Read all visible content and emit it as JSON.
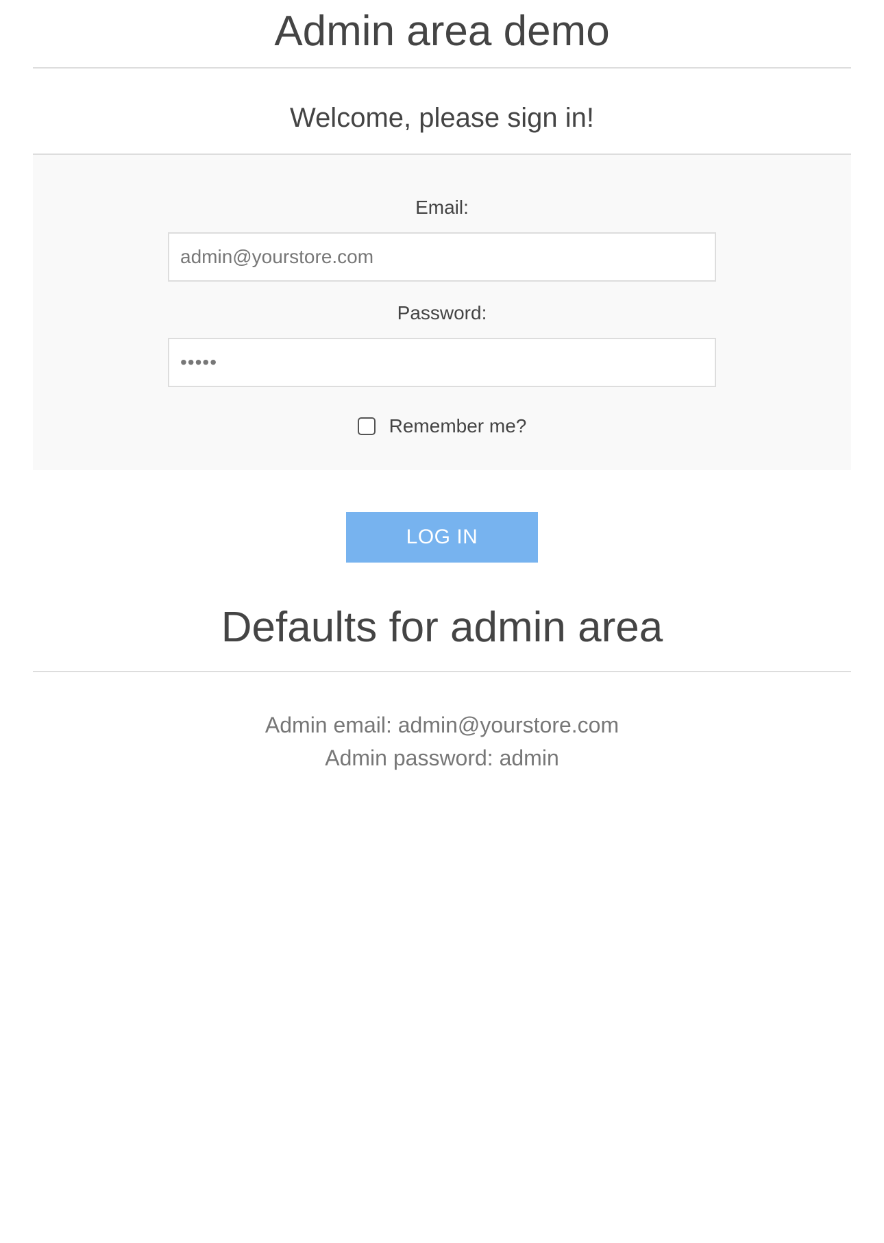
{
  "header": {
    "title": "Admin area demo"
  },
  "login": {
    "welcome": "Welcome, please sign in!",
    "email_label": "Email:",
    "email_value": "admin@yourstore.com",
    "password_label": "Password:",
    "password_value": "admin",
    "remember_label": "Remember me?",
    "remember_checked": false,
    "login_button": "LOG IN"
  },
  "defaults": {
    "title": "Defaults for admin area",
    "email_line": "Admin email: admin@yourstore.com",
    "password_line": "Admin password: admin"
  },
  "colors": {
    "button": "#77b3ef",
    "panel": "#f9f9f9",
    "text": "#444444",
    "muted_text": "#777777"
  }
}
